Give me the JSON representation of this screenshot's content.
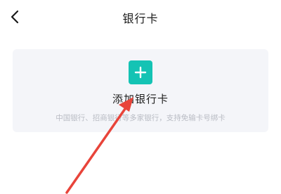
{
  "header": {
    "back_icon": "chevron-left-icon",
    "title": "银行卡"
  },
  "add_card": {
    "plus_icon": "plus-icon",
    "label": "添加银行卡",
    "description": "中国银行、招商银行等多家银行，支持免输卡号绑卡"
  },
  "colors": {
    "accent": "#14c3b4",
    "card_background": "#f4f5f9",
    "annotation_arrow": "#e8443a"
  }
}
